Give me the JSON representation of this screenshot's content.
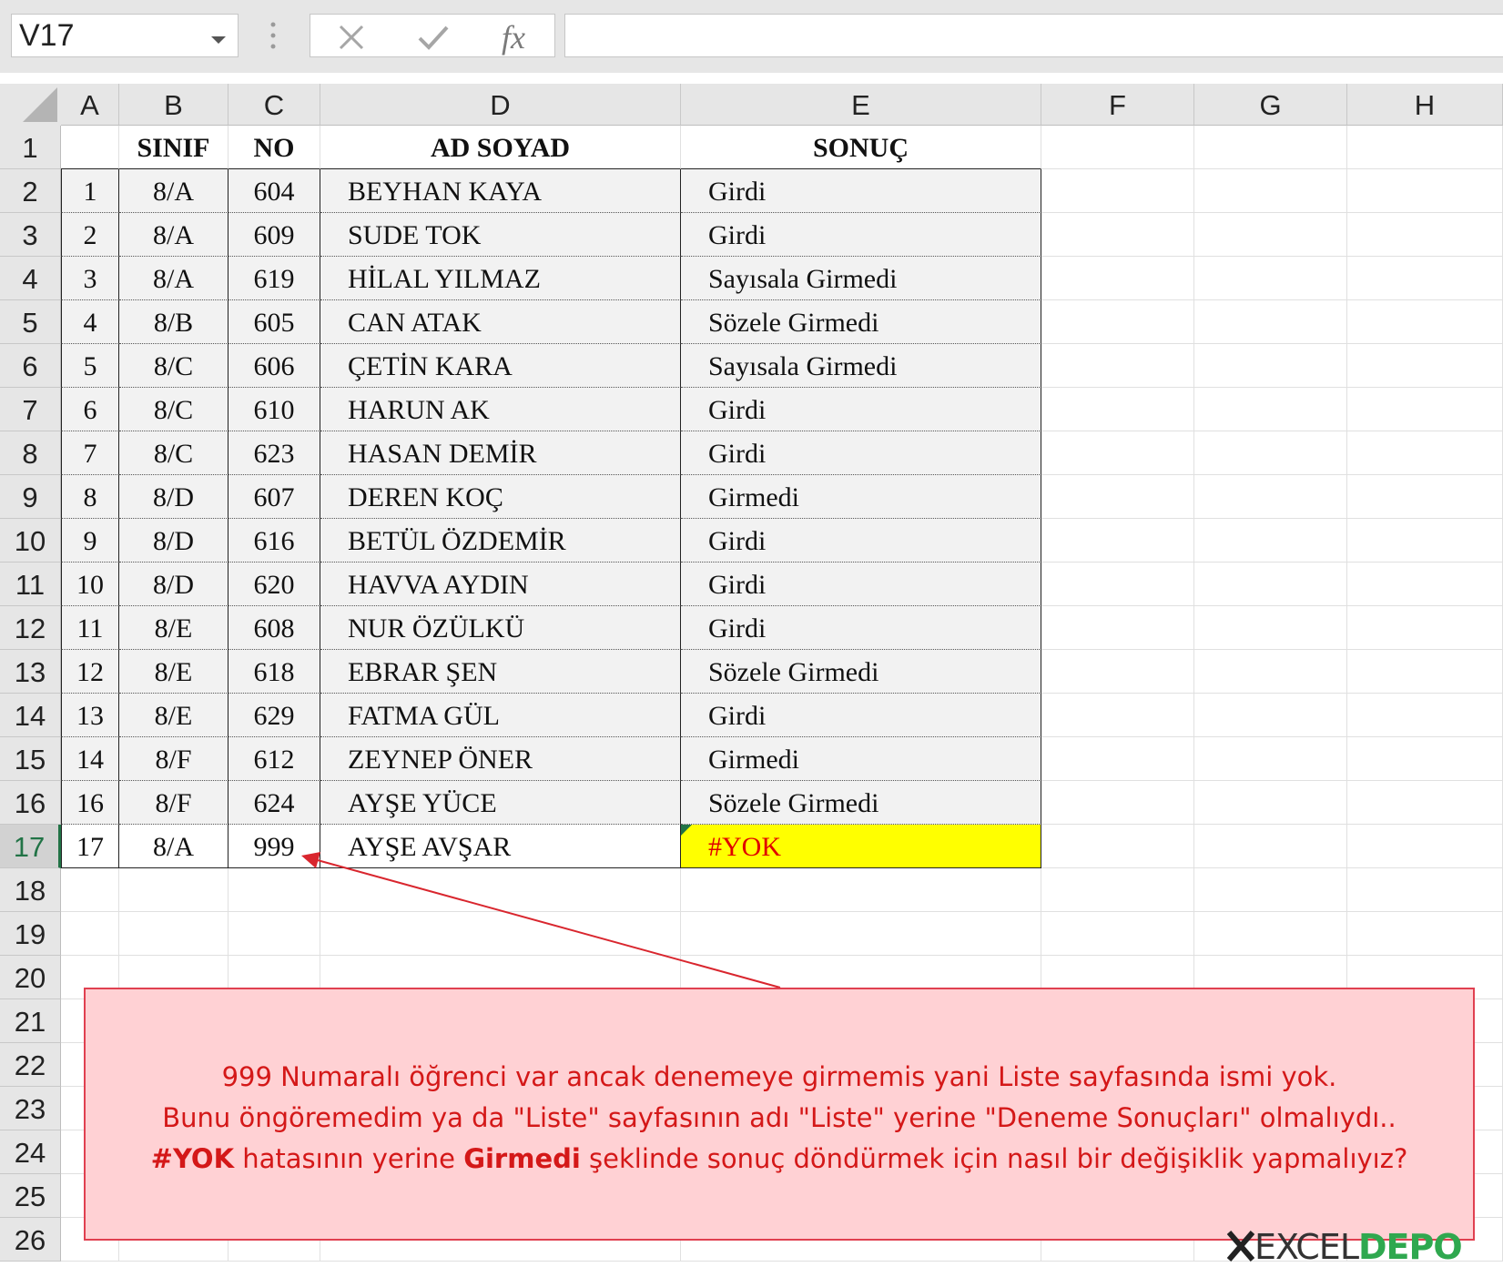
{
  "name_box": {
    "value": "V17"
  },
  "formula_bar": {
    "fx_label": "fx",
    "formula": ""
  },
  "columns": [
    "A",
    "B",
    "C",
    "D",
    "E",
    "F",
    "G",
    "H"
  ],
  "rows": [
    "1",
    "2",
    "3",
    "4",
    "5",
    "6",
    "7",
    "8",
    "9",
    "10",
    "11",
    "12",
    "13",
    "14",
    "15",
    "16",
    "17",
    "18",
    "19",
    "20",
    "21",
    "22",
    "23",
    "24",
    "25",
    "26"
  ],
  "selected_row": "17",
  "table": {
    "headers": [
      "",
      "SINIF",
      "NO",
      "AD SOYAD",
      "SONUÇ"
    ],
    "rows": [
      [
        "1",
        "8/A",
        "604",
        "BEYHAN KAYA",
        "Girdi"
      ],
      [
        "2",
        "8/A",
        "609",
        "SUDE TOK",
        "Girdi"
      ],
      [
        "3",
        "8/A",
        "619",
        "HİLAL YILMAZ",
        "Sayısala Girmedi"
      ],
      [
        "4",
        "8/B",
        "605",
        "CAN ATAK",
        "Sözele Girmedi"
      ],
      [
        "5",
        "8/C",
        "606",
        "ÇETİN KARA",
        "Sayısala Girmedi"
      ],
      [
        "6",
        "8/C",
        "610",
        "HARUN AK",
        "Girdi"
      ],
      [
        "7",
        "8/C",
        "623",
        "HASAN DEMİR",
        "Girdi"
      ],
      [
        "8",
        "8/D",
        "607",
        "DEREN KOÇ",
        "Girmedi"
      ],
      [
        "9",
        "8/D",
        "616",
        "BETÜL ÖZDEMİR",
        "Girdi"
      ],
      [
        "10",
        "8/D",
        "620",
        "HAVVA AYDIN",
        "Girdi"
      ],
      [
        "11",
        "8/E",
        "608",
        "NUR ÖZÜLKÜ",
        "Girdi"
      ],
      [
        "12",
        "8/E",
        "618",
        "EBRAR ŞEN",
        "Sözele Girmedi"
      ],
      [
        "13",
        "8/E",
        "629",
        "FATMA GÜL",
        "Girdi"
      ],
      [
        "14",
        "8/F",
        "612",
        "ZEYNEP  ÖNER",
        "Girmedi"
      ],
      [
        "16",
        "8/F",
        "624",
        "AYŞE YÜCE",
        "Sözele Girmedi"
      ],
      [
        "17",
        "8/A",
        "999",
        "AYŞE AVŞAR",
        "#YOK"
      ]
    ]
  },
  "colors": {
    "error_text": "#e00000",
    "error_fill": "#ffff00",
    "band": "#f2f2f2",
    "note_fill": "#ffd1d4",
    "note_border": "#e04050",
    "note_text": "#d41818"
  },
  "note": {
    "line1": "999 Numaralı öğrenci var ancak denemeye girmemis yani Liste sayfasında ismi yok.",
    "line2": "Bunu öngöremedim ya da \"Liste\" sayfasının adı \"Liste\" yerine \"Deneme Sonuçları\" olmalıydı..",
    "line3_bold1": "#YOK",
    "line3_mid": " hatasının yerine ",
    "line3_bold2": "Girmedi",
    "line3_end": " şeklinde sonuç döndürmek için nasıl bir değişiklik yapmalıyız?"
  },
  "logo": {
    "text_a": "EXCEL",
    "text_b": "DEPO"
  },
  "icons": [
    "chevron-down-icon",
    "more-dots-icon",
    "cancel-icon",
    "enter-check-icon",
    "fx-icon",
    "select-all-triangle-icon"
  ]
}
